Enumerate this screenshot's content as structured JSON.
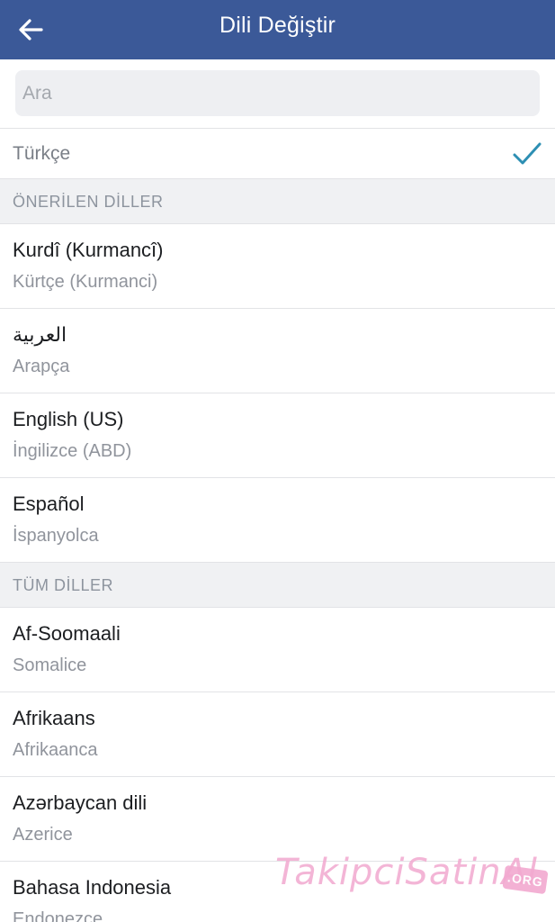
{
  "header": {
    "title": "Dili Değiştir",
    "back_icon": "arrow-left-icon"
  },
  "search": {
    "placeholder": "Ara",
    "value": ""
  },
  "selected": {
    "label": "Türkçe",
    "check_icon": "checkmark-icon",
    "check_color": "#2d8fb3"
  },
  "sections": {
    "suggested": "ÖNERİLEN DİLLER",
    "all": "TÜM DİLLER"
  },
  "suggested_languages": [
    {
      "name": "Kurdî (Kurmancî)",
      "sub": "Kürtçe (Kurmanci)"
    },
    {
      "name": "العربية",
      "sub": "Arapça"
    },
    {
      "name": "English (US)",
      "sub": "İngilizce (ABD)"
    },
    {
      "name": "Español",
      "sub": "İspanyolca"
    }
  ],
  "all_languages": [
    {
      "name": "Af-Soomaali",
      "sub": "Somalice"
    },
    {
      "name": "Afrikaans",
      "sub": "Afrikaanca"
    },
    {
      "name": "Azərbaycan dili",
      "sub": "Azerice"
    },
    {
      "name": "Bahasa Indonesia",
      "sub": "Endonezce"
    }
  ],
  "watermark": {
    "text": "TakipciSatinAl",
    "badge": ".ORG"
  },
  "colors": {
    "header_bg": "#3b5998",
    "section_bg": "#f0f1f3",
    "watermark": "#f2a9d0"
  }
}
